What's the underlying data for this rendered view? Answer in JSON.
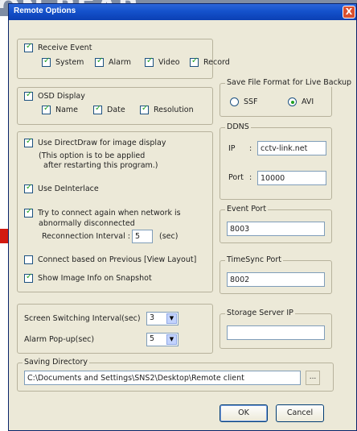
{
  "window": {
    "title": "Remote Options",
    "close_glyph": "X"
  },
  "background": {
    "banner_text": "ON BEAR"
  },
  "receive_event": {
    "label": "Receive Event",
    "checked": true,
    "options": [
      {
        "label": "System",
        "checked": true
      },
      {
        "label": "Alarm",
        "checked": true
      },
      {
        "label": "Video",
        "checked": true
      },
      {
        "label": "Record",
        "checked": true
      }
    ]
  },
  "osd_display": {
    "label": "OSD Display",
    "checked": true,
    "options": [
      {
        "label": "Name",
        "checked": true
      },
      {
        "label": "Date",
        "checked": true
      },
      {
        "label": "Resolution",
        "checked": true
      }
    ]
  },
  "display_options": {
    "direct_draw_label": "Use DirectDraw for image display",
    "direct_draw_note_1": "(This option is to be applied",
    "direct_draw_note_2": "after restarting this program.)",
    "deinterlace_label": "Use DeInterlace",
    "reconnect_label_1": "Try to connect again when network is",
    "reconnect_label_2": "abnormally disconnected",
    "reconnect_interval_label": "Reconnection Interval :",
    "reconnect_interval_value": "5",
    "reconnect_unit": "(sec)",
    "connect_previous_label": "Connect based on Previous [View Layout]",
    "show_image_info_label": "Show Image Info on Snapshot"
  },
  "save_format": {
    "title": "Save File Format for Live Backup",
    "ssf_label": "SSF",
    "avi_label": "AVI",
    "selected": "AVI"
  },
  "ddns": {
    "title": "DDNS",
    "ip_label": "IP",
    "ip_colon": ":",
    "ip_value": "cctv-link.net",
    "port_label": "Port",
    "port_colon": ":",
    "port_value": "10000"
  },
  "event_port": {
    "title": "Event Port",
    "value": "8003"
  },
  "timesync_port": {
    "title": "TimeSync Port",
    "value": "8002"
  },
  "storage_server": {
    "title": "Storage Server IP",
    "value": ""
  },
  "intervals": {
    "screen_switching_label": "Screen Switching Interval(sec)",
    "screen_switching_value": "3",
    "alarm_popup_label": "Alarm Pop-up(sec)",
    "alarm_popup_value": "5"
  },
  "saving_directory": {
    "title": "Saving Directory",
    "path": "C:\\Documents and Settings\\SNS2\\Desktop\\Remote client",
    "browse_label": "..."
  },
  "buttons": {
    "ok_label": "OK",
    "cancel_label": "Cancel"
  },
  "icons": {
    "checkbox": "checkbox-icon",
    "radio": "radio-icon",
    "dropdown": "chevron-down-icon"
  },
  "colors": {
    "titlebar": "#1452cc",
    "dialog_bg": "#ece9d8",
    "check": "#21a121"
  }
}
